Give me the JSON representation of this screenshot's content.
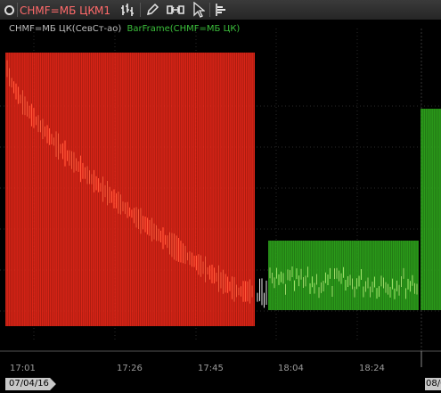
{
  "toolbar": {
    "symbol": "CHMF=МБ ЦК",
    "timeframe": "M1",
    "icons": [
      "circle-icon",
      "bar-chart-icon",
      "pencil-icon",
      "scale-icon",
      "cursor-icon",
      "dom-icon"
    ]
  },
  "legend": {
    "symbol_text": "CHMF=МБ ЦК(СевСт-ао)",
    "indicator_text": "BarFrame(CHMF=МБ ЦК)"
  },
  "x_axis": {
    "labels": [
      "17:01",
      "17:26",
      "17:45",
      "18:04",
      "18:24"
    ],
    "date_left": "07/04/16",
    "date_right": "08/0"
  },
  "colors": {
    "bear_frame": "#ff2a1a",
    "bull_frame": "#33b61f",
    "grid": "#2a2a2a",
    "background": "#000000"
  }
}
